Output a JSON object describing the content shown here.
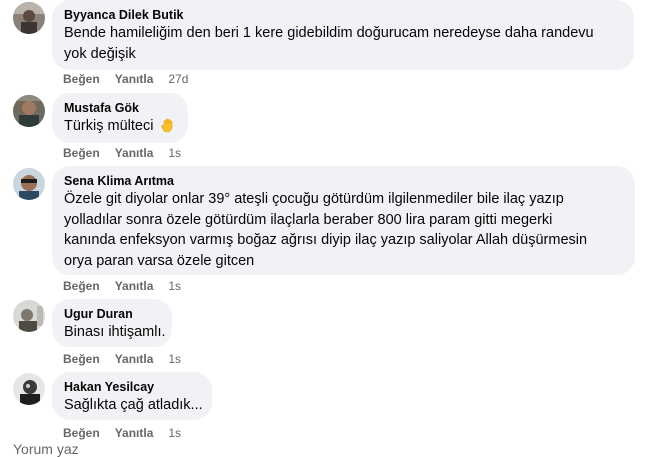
{
  "comments": [
    {
      "author": "Byyanca Dilek Butik",
      "text": "Bende hamileliğim den beri 1 kere gidebildim doğurucam neredeyse daha randevu yok değişik",
      "like_label": "Beğen",
      "reply_label": "Yanıtla",
      "time": "27d"
    },
    {
      "author": "Mustafa Gök",
      "text": "Türkiş mülteci",
      "emoji": "raised-hand-emoji",
      "like_label": "Beğen",
      "reply_label": "Yanıtla",
      "time": "1s"
    },
    {
      "author": "Sena Klima Arıtma",
      "text": "Özele git diyolar onlar 39° ateşli çocuğu götürdüm ilgilenmediler bile ilaç yazıp yolladılar sonra özele götürdüm ilaçlarla beraber 800 lira param gitti megerki kanında enfeksyon varmış boğaz ağrısı diyip ilaç yazıp saliyolar Allah düşürmesin orya paran varsa özele gitcen",
      "like_label": "Beğen",
      "reply_label": "Yanıtla",
      "time": "1s"
    },
    {
      "author": "Ugur Duran",
      "text": "Binası ihtişamlı.",
      "like_label": "Beğen",
      "reply_label": "Yanıtla",
      "time": "1s"
    },
    {
      "author": "Hakan Yesilcay",
      "text": "Sağlıkta çağ atladık...",
      "like_label": "Beğen",
      "reply_label": "Yanıtla",
      "time": "1s"
    }
  ],
  "composer": {
    "placeholder": "Yorum yaz"
  },
  "colors": {
    "bubble": "#f0f2f5",
    "meta": "#65676b",
    "text": "#050505"
  }
}
